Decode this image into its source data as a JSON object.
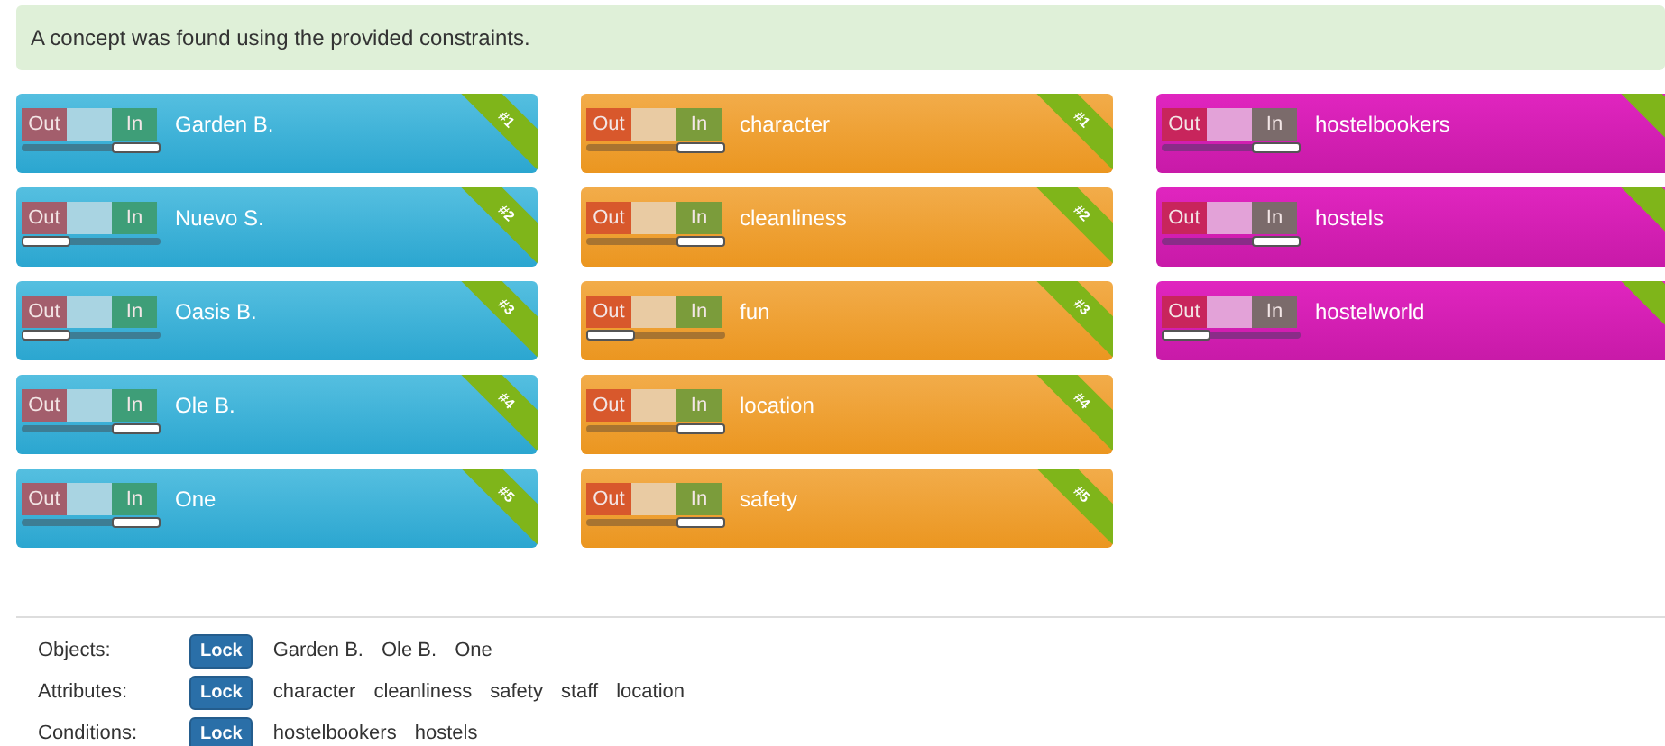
{
  "alert": {
    "text": "A concept was found using the provided constraints."
  },
  "columns": [
    {
      "kind": "object",
      "cards": [
        {
          "label": "Garden B.",
          "in": true,
          "out_label": "Out",
          "in_label": "In",
          "rank": "#1"
        },
        {
          "label": "Nuevo S.",
          "in": false,
          "out_label": "Out",
          "in_label": "In",
          "rank": "#2"
        },
        {
          "label": "Oasis B.",
          "in": false,
          "out_label": "Out",
          "in_label": "In",
          "rank": "#3"
        },
        {
          "label": "Ole B.",
          "in": true,
          "out_label": "Out",
          "in_label": "In",
          "rank": "#4"
        },
        {
          "label": "One",
          "in": true,
          "out_label": "Out",
          "in_label": "In",
          "rank": "#5"
        }
      ]
    },
    {
      "kind": "attribute",
      "cards": [
        {
          "label": "character",
          "in": true,
          "out_label": "Out",
          "in_label": "In",
          "rank": "#1"
        },
        {
          "label": "cleanliness",
          "in": true,
          "out_label": "Out",
          "in_label": "In",
          "rank": "#2"
        },
        {
          "label": "fun",
          "in": false,
          "out_label": "Out",
          "in_label": "In",
          "rank": "#3"
        },
        {
          "label": "location",
          "in": true,
          "out_label": "Out",
          "in_label": "In",
          "rank": "#4"
        },
        {
          "label": "safety",
          "in": true,
          "out_label": "Out",
          "in_label": "In",
          "rank": "#5"
        }
      ]
    },
    {
      "kind": "condition",
      "cards": [
        {
          "label": "hostelbookers",
          "in": true,
          "out_label": "Out",
          "in_label": "In"
        },
        {
          "label": "hostels",
          "in": true,
          "out_label": "Out",
          "in_label": "In"
        },
        {
          "label": "hostelworld",
          "in": false,
          "out_label": "Out",
          "in_label": "In"
        }
      ]
    }
  ],
  "summary": [
    {
      "label": "Objects:",
      "button": "Lock",
      "values": [
        "Garden B.",
        "Ole B.",
        "One"
      ]
    },
    {
      "label": "Attributes:",
      "button": "Lock",
      "values": [
        "character",
        "cleanliness",
        "safety",
        "staff",
        "location"
      ]
    },
    {
      "label": "Conditions:",
      "button": "Lock",
      "values": [
        "hostelbookers",
        "hostels"
      ]
    }
  ]
}
